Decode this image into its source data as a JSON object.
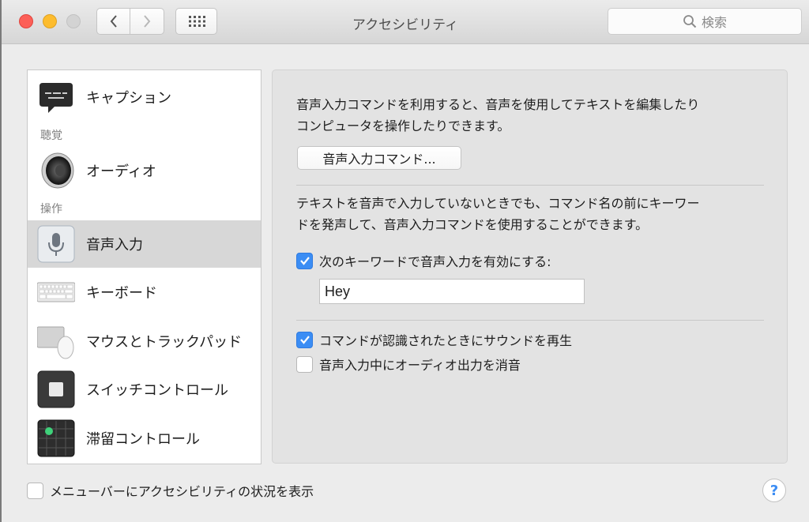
{
  "window": {
    "title": "アクセシビリティ",
    "search_placeholder": "検索"
  },
  "sidebar": {
    "items": [
      {
        "label": "キャプション",
        "icon": "caption-bubble-icon"
      },
      {
        "header": "聴覚"
      },
      {
        "label": "オーディオ",
        "icon": "speaker-icon"
      },
      {
        "header": "操作"
      },
      {
        "label": "音声入力",
        "icon": "microphone-icon",
        "selected": true
      },
      {
        "label": "キーボード",
        "icon": "keyboard-icon"
      },
      {
        "label": "マウスとトラックパッド",
        "icon": "mouse-trackpad-icon"
      },
      {
        "label": "スイッチコントロール",
        "icon": "switch-control-icon"
      },
      {
        "label": "滞留コントロール",
        "icon": "dwell-control-icon"
      }
    ]
  },
  "panel": {
    "intro_line1": "音声入力コマンドを利用すると、音声を使用してテキストを編集したり",
    "intro_line2": "コンピュータを操作したりできます。",
    "commands_button": "音声入力コマンド...",
    "keyword_line1": "テキストを音声で入力していないときでも、コマンド名の前にキーワー",
    "keyword_line2": "ドを発声して、音声入力コマンドを使用することができます。",
    "enable_keyword_label": "次のキーワードで音声入力を有効にする:",
    "enable_keyword_checked": true,
    "keyword_value": "Hey",
    "play_sound_label": "コマンドが認識されたときにサウンドを再生",
    "play_sound_checked": true,
    "mute_audio_label": "音声入力中にオーディオ出力を消音",
    "mute_audio_checked": false
  },
  "footer": {
    "menubar_status_label": "メニューバーにアクセシビリティの状況を表示",
    "menubar_status_checked": false,
    "help_label": "?"
  },
  "colors": {
    "accent": "#3b8df4",
    "close": "#fc5f57",
    "minimize": "#fdbc2e",
    "maximize_disabled": "#d3d3d3",
    "selection": "#d7d7d7"
  }
}
